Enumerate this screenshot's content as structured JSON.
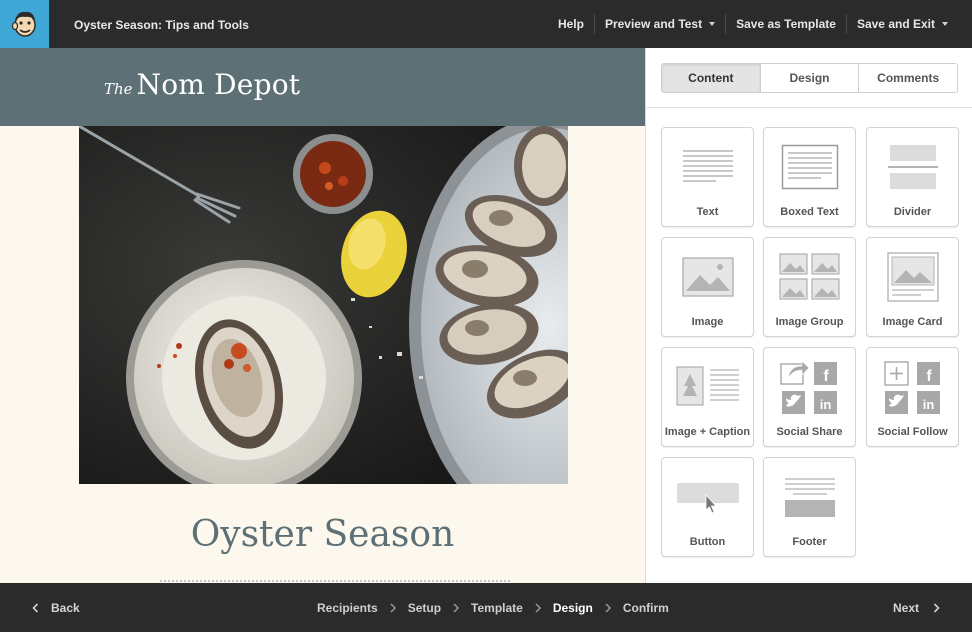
{
  "app": {
    "title": "Oyster Season: Tips and Tools"
  },
  "topnav": {
    "help": "Help",
    "preview": "Preview and Test",
    "save_template": "Save as Template",
    "save_exit": "Save and Exit"
  },
  "email": {
    "brand_prefix": "The",
    "brand_name": "Nom Depot",
    "heading": "Oyster Season"
  },
  "panel": {
    "tabs": [
      "Content",
      "Design",
      "Comments"
    ],
    "active_tab": "Content",
    "blocks": [
      {
        "label": "Text",
        "icon": "text-block-icon"
      },
      {
        "label": "Boxed Text",
        "icon": "boxed-text-block-icon"
      },
      {
        "label": "Divider",
        "icon": "divider-block-icon"
      },
      {
        "label": "Image",
        "icon": "image-block-icon"
      },
      {
        "label": "Image Group",
        "icon": "image-group-block-icon"
      },
      {
        "label": "Image Card",
        "icon": "image-card-block-icon"
      },
      {
        "label": "Image + Caption",
        "icon": "image-caption-block-icon"
      },
      {
        "label": "Social Share",
        "icon": "social-share-block-icon"
      },
      {
        "label": "Social Follow",
        "icon": "social-follow-block-icon"
      },
      {
        "label": "Button",
        "icon": "button-block-icon"
      },
      {
        "label": "Footer",
        "icon": "footer-block-icon"
      }
    ]
  },
  "bottom": {
    "back": "Back",
    "next": "Next",
    "steps": [
      "Recipients",
      "Setup",
      "Template",
      "Design",
      "Confirm"
    ],
    "current_step": "Design"
  },
  "colors": {
    "topbar": "#2b2b2b",
    "logo_bg": "#3fa7d6",
    "email_header": "#5d7075",
    "email_bg": "#fdf8ee",
    "heading_color": "#5d7075"
  }
}
